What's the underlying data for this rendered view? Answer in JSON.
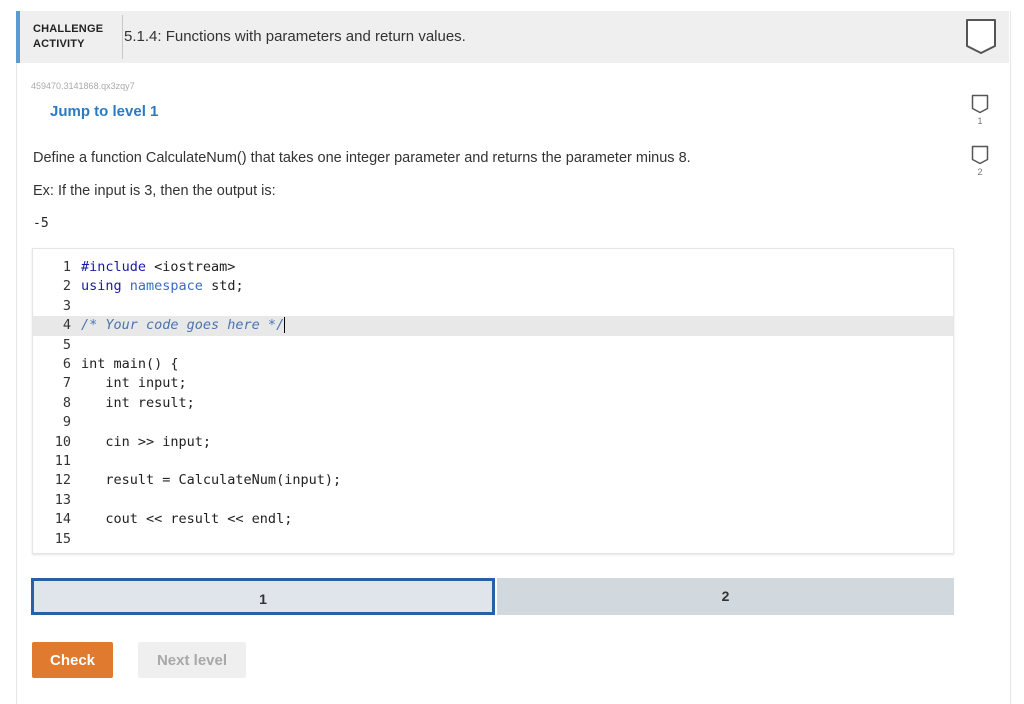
{
  "header": {
    "label_line1": "CHALLENGE",
    "label_line2": "ACTIVITY",
    "title": "5.1.4: Functions with parameters and return values."
  },
  "activity_code": "459470.3141868.qx3zqy7",
  "jump_link": "Jump to level 1",
  "prompt": "Define a function CalculateNum() that takes one integer parameter and returns the parameter minus 8.",
  "example": "Ex: If the input is 3, then the output is:",
  "example_output": "-5",
  "side_levels": [
    {
      "label": "1"
    },
    {
      "label": "2"
    }
  ],
  "code_lines": [
    {
      "n": "1",
      "text": "#include <iostream>"
    },
    {
      "n": "2",
      "text": "using namespace std;"
    },
    {
      "n": "3",
      "text": ""
    },
    {
      "n": "4",
      "text": "/* Your code goes here */"
    },
    {
      "n": "5",
      "text": ""
    },
    {
      "n": "6",
      "text": "int main() {"
    },
    {
      "n": "7",
      "text": "   int input;"
    },
    {
      "n": "8",
      "text": "   int result;"
    },
    {
      "n": "9",
      "text": ""
    },
    {
      "n": "10",
      "text": "   cin >> input;"
    },
    {
      "n": "11",
      "text": ""
    },
    {
      "n": "12",
      "text": "   result = CalculateNum(input);"
    },
    {
      "n": "13",
      "text": ""
    },
    {
      "n": "14",
      "text": "   cout << result << endl;"
    },
    {
      "n": "15",
      "text": ""
    }
  ],
  "level_tabs": [
    {
      "label": "1",
      "active": true
    },
    {
      "label": "2",
      "active": false
    }
  ],
  "buttons": {
    "check": "Check",
    "next_level": "Next level"
  },
  "colors": {
    "accent": "#5b9bd5",
    "check_button": "#e07a2e",
    "active_level_border": "#2a5ea7",
    "link": "#2b7bc2"
  },
  "icons": {
    "header_icon": "shield-icon",
    "level_icon": "shield-icon"
  }
}
